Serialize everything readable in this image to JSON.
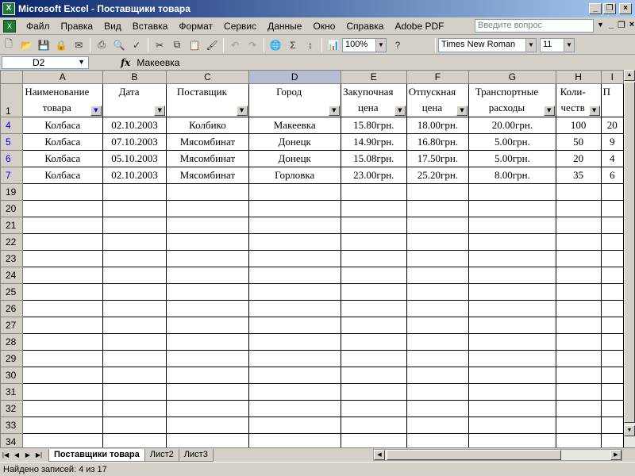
{
  "window": {
    "title": "Microsoft Excel - Поставщики товара",
    "app_icon": "X"
  },
  "menu": {
    "items": [
      "Файл",
      "Правка",
      "Вид",
      "Вставка",
      "Формат",
      "Сервис",
      "Данные",
      "Окно",
      "Справка",
      "Adobe PDF"
    ],
    "ask_placeholder": "Введите вопрос"
  },
  "toolbar": {
    "zoom": "100%",
    "font_name": "Times New Roman",
    "font_size": "11"
  },
  "formula_bar": {
    "cell_ref": "D2",
    "fx_label": "fx",
    "value": "Макеевка"
  },
  "sheet": {
    "columns": [
      "A",
      "B",
      "C",
      "D",
      "E",
      "F",
      "G",
      "H",
      "I"
    ],
    "active_column": "D",
    "header_row_number": "1",
    "headers": [
      {
        "text": "Наименование товара",
        "filter_active": true
      },
      {
        "text": "Дата",
        "filter_active": false
      },
      {
        "text": "Поставщик",
        "filter_active": false
      },
      {
        "text": "Город",
        "filter_active": false
      },
      {
        "text": "Закупочная цена",
        "filter_active": false
      },
      {
        "text": "Отпускная цена",
        "filter_active": false
      },
      {
        "text": "Транспортные расходы",
        "filter_active": false
      },
      {
        "text": "Коли- честв",
        "filter_active": false
      },
      {
        "text": "П",
        "filter_active": false
      }
    ],
    "rows": [
      {
        "num": "4",
        "cells": [
          "Колбаса",
          "02.10.2003",
          "Колбико",
          "Макеевка",
          "15.80грн.",
          "18.00грн.",
          "20.00грн.",
          "100",
          "20"
        ]
      },
      {
        "num": "5",
        "cells": [
          "Колбаса",
          "07.10.2003",
          "Мясомбинат",
          "Донецк",
          "14.90грн.",
          "16.80грн.",
          "5.00грн.",
          "50",
          "9"
        ]
      },
      {
        "num": "6",
        "cells": [
          "Колбаса",
          "05.10.2003",
          "Мясомбинат",
          "Донецк",
          "15.08грн.",
          "17.50грн.",
          "5.00грн.",
          "20",
          "4"
        ]
      },
      {
        "num": "7",
        "cells": [
          "Колбаса",
          "02.10.2003",
          "Мясомбинат",
          "Горловка",
          "23.00грн.",
          "25.20грн.",
          "8.00грн.",
          "35",
          "6"
        ]
      }
    ],
    "empty_rows": [
      "19",
      "20",
      "21",
      "22",
      "23",
      "24",
      "25",
      "26",
      "27",
      "28",
      "29",
      "30",
      "31",
      "32",
      "33",
      "34"
    ]
  },
  "tabs": {
    "items": [
      "Поставщики товара",
      "Лист2",
      "Лист3"
    ],
    "active": 0
  },
  "status": {
    "text": "Найдено записей: 4 из 17"
  }
}
